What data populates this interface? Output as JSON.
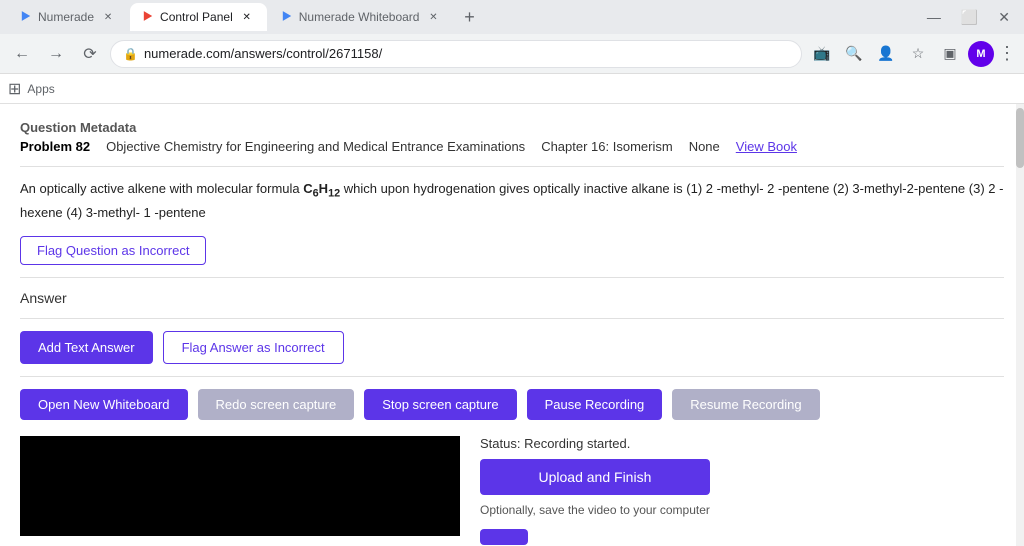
{
  "browser": {
    "tabs": [
      {
        "id": "tab1",
        "label": "Numerade",
        "active": false,
        "favicon": "blue"
      },
      {
        "id": "tab2",
        "label": "Control Panel",
        "active": true,
        "favicon": "red"
      },
      {
        "id": "tab3",
        "label": "Numerade Whiteboard",
        "active": false,
        "favicon": "blue"
      }
    ],
    "url": "numerade.com/answers/control/2671158/",
    "profile_initial": "M"
  },
  "apps_bar": {
    "label": "Apps"
  },
  "page": {
    "section_title": "Question Metadata",
    "problem_number": "Problem 82",
    "meta_items": [
      "Objective Chemistry for Engineering and Medical Entrance Examinations",
      "Chapter 16: Isomerism",
      "None",
      "View Book"
    ],
    "question_text": "An optically active alkene with molecular formula C₆H₁₂ which upon hydrogenation gives optically inactive alkane is (1) 2 -methyl- 2 -pentene (2) 3-methyl-2-pentene (3) 2 -hexene (4) 3-methyl- 1 -pentene",
    "flag_question_label": "Flag Question as Incorrect",
    "answer_label": "Answer",
    "add_text_label": "Add Text Answer",
    "flag_answer_label": "Flag Answer as Incorrect",
    "buttons": {
      "open_whiteboard": "Open New Whiteboard",
      "redo_capture": "Redo screen capture",
      "stop_capture": "Stop screen capture",
      "pause_recording": "Pause Recording",
      "resume_recording": "Resume Recording"
    },
    "status_text": "Status: Recording started.",
    "upload_finish_label": "Upload and Finish",
    "optional_text": "Optionally, save the video to your computer"
  }
}
